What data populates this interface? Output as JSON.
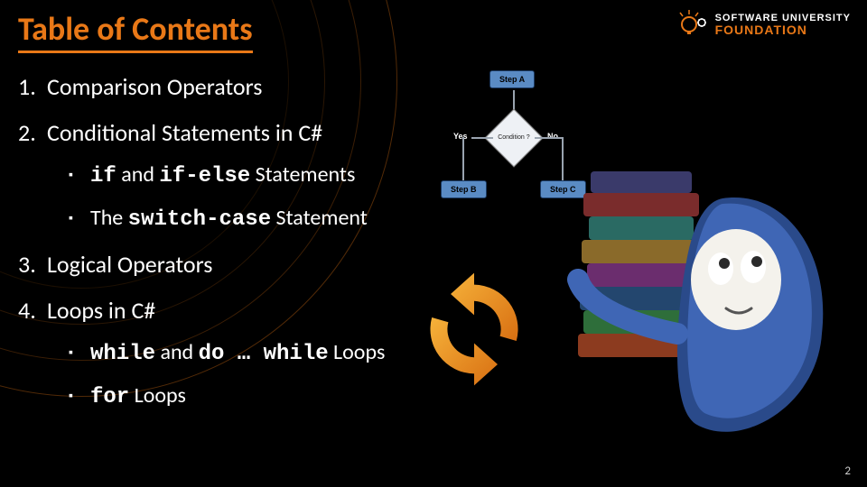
{
  "title": "Table of Contents",
  "brand": {
    "line1": "SOFTWARE UNIVERSITY",
    "line2": "FOUNDATION"
  },
  "toc": {
    "item1": "Comparison Operators",
    "item2": "Conditional Statements in C#",
    "item2_sub1_code1": "if",
    "item2_sub1_mid": " and ",
    "item2_sub1_code2": "if-else",
    "item2_sub1_tail": " Statements",
    "item2_sub2_pre": "The ",
    "item2_sub2_code": "switch-case",
    "item2_sub2_tail": " Statement",
    "item3": "Logical Operators",
    "item4": "Loops in C#",
    "item4_sub1_code1": "while",
    "item4_sub1_mid": " and ",
    "item4_sub1_code2": "do … while",
    "item4_sub1_tail": " Loops",
    "item4_sub2_code": "for",
    "item4_sub2_tail": " Loops"
  },
  "flowchart": {
    "stepA": "Step A",
    "condition": "Condition ?",
    "yes": "Yes",
    "no": "No",
    "stepB": "Step B",
    "stepC": "Step C"
  },
  "page_number": "2",
  "colors": {
    "accent": "#e97817",
    "box_blue": "#5a8bc4"
  }
}
